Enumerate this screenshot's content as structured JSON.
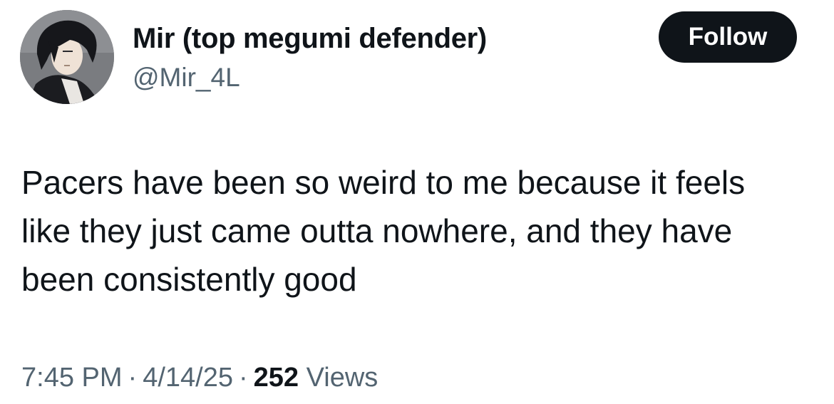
{
  "author": {
    "display_name": "Mir (top megumi defender)",
    "handle": "@Mir_4L",
    "avatar_icon": "anime-character-avatar"
  },
  "follow_button": {
    "label": "Follow"
  },
  "tweet": {
    "text": "Pacers have been so weird to me because it feels\nlike they just came outta nowhere, and they have\nbeen consistently good"
  },
  "meta": {
    "time": "7:45 PM",
    "date": "4/14/25",
    "separator": "·",
    "views_count": "252",
    "views_label": "Views"
  },
  "colors": {
    "text_primary": "#0f1419",
    "text_secondary": "#536471",
    "button_background": "#0f1419",
    "button_text": "#ffffff"
  }
}
